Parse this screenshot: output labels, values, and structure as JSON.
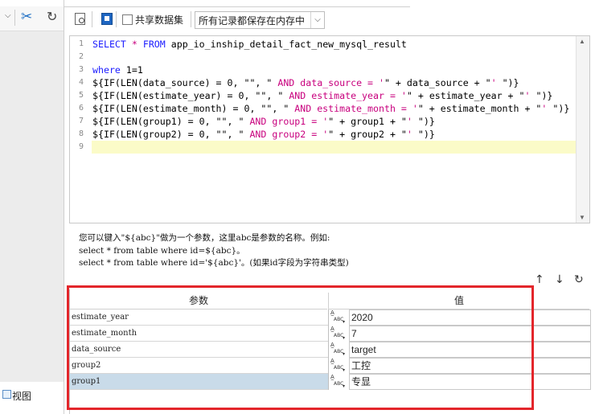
{
  "left_panel": {
    "view_tab_label": "视图"
  },
  "toolbar": {
    "share_dataset_label": "共享数据集",
    "share_dataset_checked": false,
    "cache_select_value": "所有记录都保存在内存中"
  },
  "editor": {
    "lines": [
      {
        "n": "1",
        "html": "<span class=\"kw\">SELECT</span> <span class=\"op\">*</span> <span class=\"kw\">FROM</span> app_io_inship_detail_fact_new_mysql_result"
      },
      {
        "n": "2",
        "html": ""
      },
      {
        "n": "3",
        "html": "<span class=\"kw\">where</span> 1=1"
      },
      {
        "n": "4",
        "html": "${IF(LEN(data_source) = 0, \"\", \" <span class=\"str\">AND data_source = '</span>\" + data_source + \"<span class=\"str\">' </span>\")}"
      },
      {
        "n": "5",
        "html": "${IF(LEN(estimate_year) = 0, \"\", \" <span class=\"str\">AND estimate_year = '</span>\" + estimate_year + \"<span class=\"str\">' </span>\")}"
      },
      {
        "n": "6",
        "html": "${IF(LEN(estimate_month) = 0, \"\", \" <span class=\"str\">AND estimate_month = '</span>\" + estimate_month + \"<span class=\"str\">' </span>\")}"
      },
      {
        "n": "7",
        "html": "${IF(LEN(group1) = 0, \"\", \" <span class=\"str\">AND group1 = '</span>\" + group1 + \"<span class=\"str\">' </span>\")}"
      },
      {
        "n": "8",
        "html": "${IF(LEN(group2) = 0, \"\", \" <span class=\"str\">AND group2 = '</span>\" + group2 + \"<span class=\"str\">' </span>\")}"
      },
      {
        "n": "9",
        "html": ""
      }
    ]
  },
  "hint": {
    "line1": "您可以键入\"${abc}\"做为一个参数，这里abc是参数的名称。例如:",
    "line2": "select * from table where id=${abc}。",
    "line3": "select * from table where id='${abc}'。(如果id字段为字符串类型)"
  },
  "params": {
    "col_name": "参数",
    "col_value": "值",
    "type_label": "ABC",
    "rows": [
      {
        "name": "estimate_year",
        "value": "2020"
      },
      {
        "name": "estimate_month",
        "value": "7"
      },
      {
        "name": "data_source",
        "value": "target"
      },
      {
        "name": "group2",
        "value": "工控"
      },
      {
        "name": "group1",
        "value": "专显"
      }
    ]
  },
  "colors": {
    "highlight_box": "#e3262b",
    "selected_row": "#c9dbe9",
    "keyword": "#1a1aff",
    "string": "#c8007e"
  }
}
